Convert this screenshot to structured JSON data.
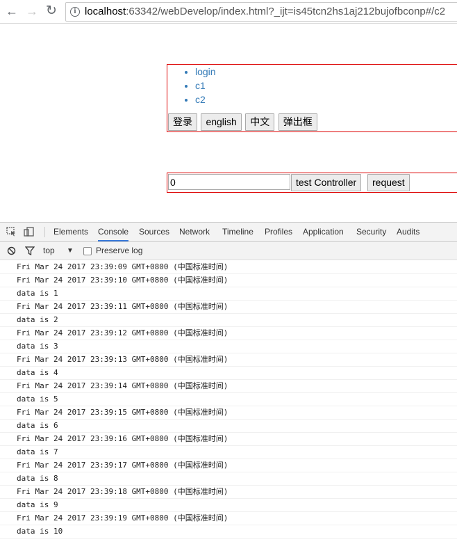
{
  "browser": {
    "url_host": "localhost",
    "url_rest": ":63342/webDevelop/index.html?_ijt=is45tcn2hs1aj212bujofbconp#/c2"
  },
  "page": {
    "nav": [
      "login",
      "c1",
      "c2"
    ],
    "buttons": [
      "登录",
      "english",
      "中文",
      "弹出框"
    ],
    "input_value": "0",
    "test_controller_label": "test Controller",
    "request_label": "request"
  },
  "devtools": {
    "tabs": [
      "Elements",
      "Console",
      "Sources",
      "Network",
      "Timeline",
      "Profiles",
      "Application",
      "Security",
      "Audits"
    ],
    "active_tab": "Console",
    "context": "top",
    "preserve_log": "Preserve log"
  },
  "console": {
    "lines": [
      "Fri Mar 24 2017 23:39:09 GMT+0800 (中国标准时间)",
      "Fri Mar 24 2017 23:39:10 GMT+0800 (中国标准时间)",
      "data is 1",
      "Fri Mar 24 2017 23:39:11 GMT+0800 (中国标准时间)",
      "data is 2",
      "Fri Mar 24 2017 23:39:12 GMT+0800 (中国标准时间)",
      "data is 3",
      "Fri Mar 24 2017 23:39:13 GMT+0800 (中国标准时间)",
      "data is 4",
      "Fri Mar 24 2017 23:39:14 GMT+0800 (中国标准时间)",
      "data is 5",
      "Fri Mar 24 2017 23:39:15 GMT+0800 (中国标准时间)",
      "data is 6",
      "Fri Mar 24 2017 23:39:16 GMT+0800 (中国标准时间)",
      "data is 7",
      "Fri Mar 24 2017 23:39:17 GMT+0800 (中国标准时间)",
      "data is 8",
      "Fri Mar 24 2017 23:39:18 GMT+0800 (中国标准时间)",
      "data is 9",
      "Fri Mar 24 2017 23:39:19 GMT+0800 (中国标准时间)",
      "data is 10"
    ]
  }
}
